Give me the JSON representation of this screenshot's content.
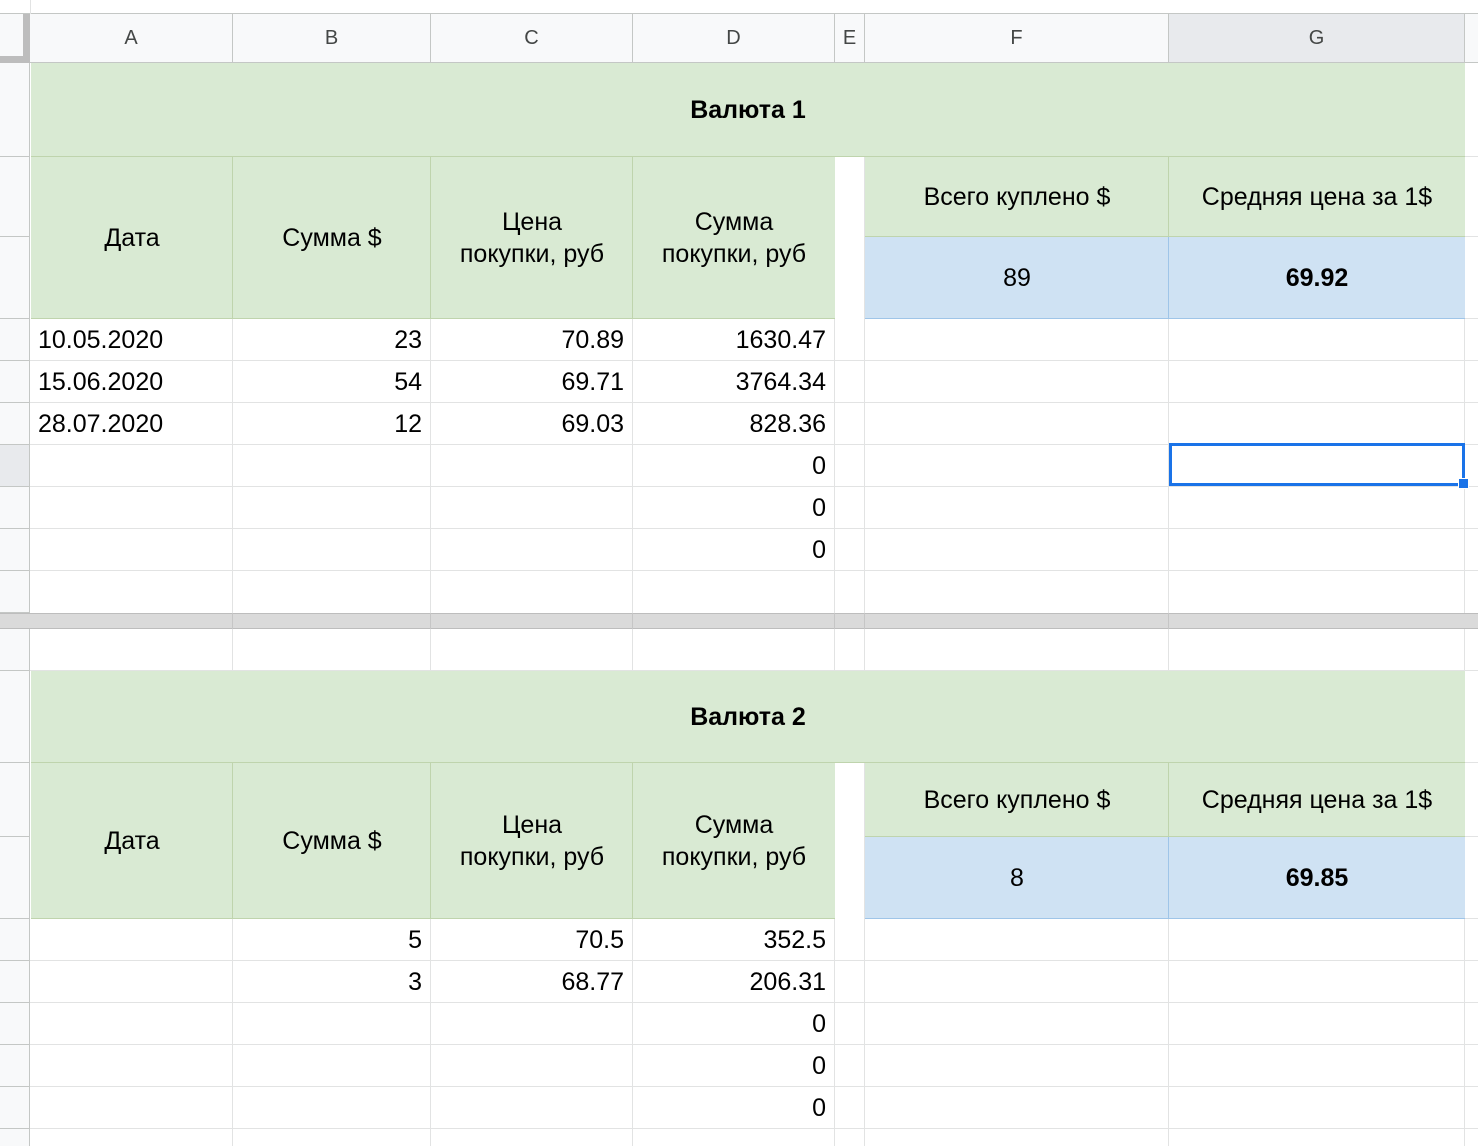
{
  "columns": [
    "A",
    "B",
    "C",
    "D",
    "E",
    "F",
    "G"
  ],
  "blocks": [
    {
      "title": "Валюта 1",
      "headers": {
        "date": "Дата",
        "amount": "Сумма $",
        "price": "Цена покупки, руб",
        "total": "Сумма покупки, руб"
      },
      "summary": {
        "bought_label": "Всего куплено $",
        "avg_label": "Средняя цена за 1$",
        "bought_value": "89",
        "avg_value": "69.92"
      },
      "rows": [
        {
          "date": "10.05.2020",
          "amount": "23",
          "price": "70.89",
          "total": "1630.47"
        },
        {
          "date": "15.06.2020",
          "amount": "54",
          "price": "69.71",
          "total": "3764.34"
        },
        {
          "date": "28.07.2020",
          "amount": "12",
          "price": "69.03",
          "total": "828.36"
        },
        {
          "date": "",
          "amount": "",
          "price": "",
          "total": "0"
        },
        {
          "date": "",
          "amount": "",
          "price": "",
          "total": "0"
        },
        {
          "date": "",
          "amount": "",
          "price": "",
          "total": "0"
        },
        {
          "date": "",
          "amount": "",
          "price": "",
          "total": ""
        }
      ]
    },
    {
      "title": "Валюта 2",
      "headers": {
        "date": "Дата",
        "amount": "Сумма $",
        "price": "Цена покупки, руб",
        "total": "Сумма покупки, руб"
      },
      "summary": {
        "bought_label": "Всего куплено $",
        "avg_label": "Средняя цена за 1$",
        "bought_value": "8",
        "avg_value": "69.85"
      },
      "rows": [
        {
          "date": "",
          "amount": "5",
          "price": "70.5",
          "total": "352.5"
        },
        {
          "date": "",
          "amount": "3",
          "price": "68.77",
          "total": "206.31"
        },
        {
          "date": "",
          "amount": "",
          "price": "",
          "total": "0"
        },
        {
          "date": "",
          "amount": "",
          "price": "",
          "total": "0"
        },
        {
          "date": "",
          "amount": "",
          "price": "",
          "total": "0"
        }
      ]
    }
  ],
  "selection": {
    "column": "G"
  }
}
